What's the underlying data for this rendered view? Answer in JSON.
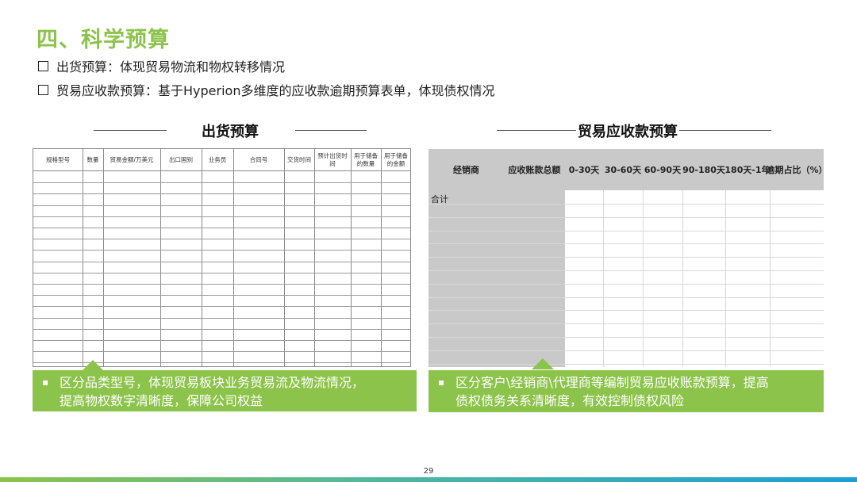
{
  "title": "四、科学预算",
  "bullets": [
    "出货预算：体现贸易物流和物权转移情况",
    "贸易应收款预算：基于Hyperion多维度的应收款逾期预算表单，体现债权情况"
  ],
  "left": {
    "section_title": "出货预算",
    "columns": [
      "规格型号",
      "数量",
      "贸易金额/万美元",
      "出口国别",
      "业务员",
      "合同号",
      "交货时间",
      "预计出货时间",
      "用于储备的数量",
      "用于储备的金额"
    ],
    "callout": [
      "区分品类型号，体现贸易板块业务贸易流及物流情况，",
      "提高物权数字清晰度，保障公司权益"
    ]
  },
  "right": {
    "section_title": "贸易应收款预算",
    "columns": [
      "经销商",
      "应收账款总额",
      "0-30天",
      "30-60天",
      "60-90天",
      "90-180天",
      "180天-1年",
      "逾期占比（%）"
    ],
    "total_label": "合计",
    "callout": [
      "区分客户\\经销商\\代理商等编制贸易应收账款预算，提高",
      "债权债务关系清晰度，有效控制债权风险"
    ]
  },
  "page_number": "29"
}
